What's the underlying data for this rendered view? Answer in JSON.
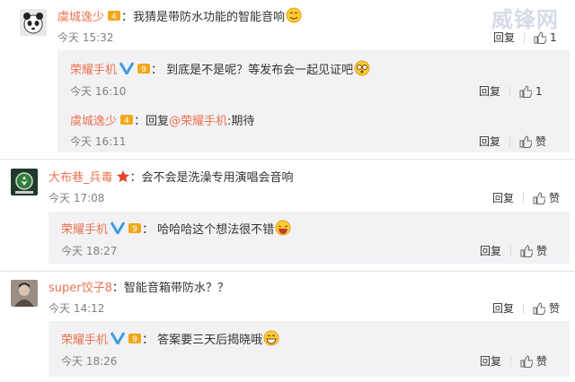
{
  "colors": {
    "name": "#eb7350",
    "text": "#333333",
    "time": "#808080",
    "reply_bg": "#f2f2f5",
    "vip": "#3e9dde"
  },
  "watermark": "威锋网",
  "actions": {
    "reply": "回复",
    "praise": "赞"
  },
  "comments": [
    {
      "user": "虞城逸少",
      "text": "：我猜是带防水功能的智能音响",
      "time": "今天 15:32",
      "likes": "1",
      "replies": [
        {
          "user": "荣耀手机",
          "text": "：  到底是不是呢？等发布会一起见证吧",
          "time": "今天 16:10",
          "likes": "1"
        },
        {
          "user": "虞城逸少",
          "text": "：回复",
          "mention": "@荣耀手机",
          "text2": ":期待",
          "time": "今天 16:11",
          "likes": "赞"
        }
      ]
    },
    {
      "user": "大布巷_兵毒",
      "text": "：会不会是洗澡专用演唱会音响",
      "time": "今天 17:08",
      "likes": "赞",
      "replies": [
        {
          "user": "荣耀手机",
          "text": "：  哈哈哈这个想法很不错",
          "time": "今天 18:27",
          "likes": "赞"
        }
      ]
    },
    {
      "user": "super饺子8",
      "text": "：智能音箱带防水？？",
      "time": "今天 14:12",
      "likes": "赞",
      "replies": [
        {
          "user": "荣耀手机",
          "text": "：  答案要三天后揭晓哦",
          "time": "今天 18:26",
          "likes": "赞"
        }
      ]
    }
  ]
}
